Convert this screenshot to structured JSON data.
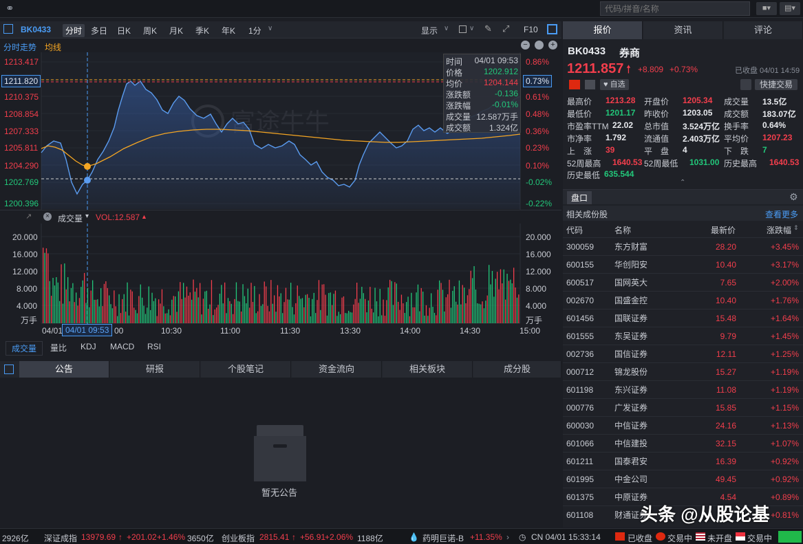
{
  "topbar": {
    "search_placeholder": "代码/拼音/名称"
  },
  "chartbar": {
    "code": "BK0433",
    "periods": [
      "分时",
      "多日",
      "日K",
      "周K",
      "月K",
      "季K",
      "年K",
      "1分"
    ],
    "display_label": "显示",
    "f10_label": "F10"
  },
  "legend": {
    "tab_intraday": "分时走势",
    "tab_avg": "均线"
  },
  "price_axis": {
    "left": [
      "1213.417",
      "1211.820",
      "1210.375",
      "1208.854",
      "1207.333",
      "1205.811",
      "1204.290",
      "1202.769",
      "1200.396"
    ],
    "right": [
      "0.86%",
      "0.73%",
      "0.61%",
      "0.48%",
      "0.36%",
      "0.23%",
      "0.10%",
      "-0.02%",
      "-0.22%"
    ]
  },
  "tooltip": {
    "rows": [
      {
        "label": "时间",
        "value": "04/01 09:53"
      },
      {
        "label": "价格",
        "value": "1202.912"
      },
      {
        "label": "均价",
        "value": "1204.144"
      },
      {
        "label": "涨跌额",
        "value": "-0.136"
      },
      {
        "label": "涨跌幅",
        "value": "-0.01%"
      },
      {
        "label": "成交量",
        "value": "12.587万手"
      },
      {
        "label": "成交额",
        "value": "1.324亿"
      }
    ]
  },
  "watermark": "富途牛牛",
  "volume": {
    "label": "成交量",
    "vol_text": "VOL:12.587",
    "axis": [
      "20.000",
      "16.000",
      "12.000",
      "8.000",
      "4.000",
      "万手"
    ]
  },
  "time_axis": [
    "04/01",
    "10:30",
    "11:00",
    "11:30",
    "13:30",
    "14:00",
    "14:30",
    "15:00"
  ],
  "cursor_time": "04/01 09:53",
  "indicators": [
    "成交量",
    "量比",
    "KDJ",
    "MACD",
    "RSI"
  ],
  "bottom_tabs": [
    "公告",
    "研报",
    "个股笔记",
    "资金流向",
    "相关板块",
    "成分股"
  ],
  "empty_text": "暂无公告",
  "right": {
    "tabs": [
      "报价",
      "资讯",
      "评论"
    ],
    "code": "BK0433",
    "name": "券商",
    "price": "1211.857",
    "change": "+8.809",
    "change_pct": "+0.73%",
    "close_status": "已收盘 04/01 14:59",
    "watch_label": "自选",
    "trade_label": "快捷交易",
    "quote": [
      [
        "最高价",
        "1213.28",
        "开盘价",
        "1205.34",
        "成交量",
        "13.5亿"
      ],
      [
        "最低价",
        "1201.17",
        "昨收价",
        "1203.05",
        "成交额",
        "183.07亿"
      ],
      [
        "市盈率TTM",
        "22.02",
        "总市值",
        "3.524万亿",
        "换手率",
        "0.64%"
      ],
      [
        "市净率",
        "1.792",
        "流通值",
        "2.403万亿",
        "平均价",
        "1207.23"
      ],
      [
        "上　涨",
        "39",
        "平　盘",
        "4",
        "下　跌",
        "7"
      ],
      [
        "52周最高",
        "1640.53",
        "52周最低",
        "1031.00",
        "历史最高",
        "1640.53"
      ]
    ],
    "hist_low_label": "历史最低",
    "hist_low": "635.544",
    "pankou": "盘口",
    "related_title": "相关成份股",
    "see_more": "查看更多",
    "table_headers": [
      "代码",
      "名称",
      "最新价",
      "涨跌幅"
    ],
    "stocks": [
      [
        "300059",
        "东方财富",
        "28.20",
        "+3.45%"
      ],
      [
        "600155",
        "华创阳安",
        "10.40",
        "+3.17%"
      ],
      [
        "600517",
        "国网英大",
        "7.65",
        "+2.00%"
      ],
      [
        "002670",
        "国盛金控",
        "10.40",
        "+1.76%"
      ],
      [
        "601456",
        "国联证券",
        "15.48",
        "+1.64%"
      ],
      [
        "601555",
        "东吴证券",
        "9.79",
        "+1.45%"
      ],
      [
        "002736",
        "国信证券",
        "12.11",
        "+1.25%"
      ],
      [
        "000712",
        "锦龙股份",
        "15.27",
        "+1.19%"
      ],
      [
        "601198",
        "东兴证券",
        "11.08",
        "+1.19%"
      ],
      [
        "000776",
        "广发证券",
        "15.85",
        "+1.15%"
      ],
      [
        "600030",
        "中信证券",
        "24.16",
        "+1.13%"
      ],
      [
        "601066",
        "中信建投",
        "32.15",
        "+1.07%"
      ],
      [
        "601211",
        "国泰君安",
        "16.39",
        "+0.92%"
      ],
      [
        "601995",
        "中金公司",
        "49.45",
        "+0.92%"
      ],
      [
        "601375",
        "中原证券",
        "4.54",
        "+0.89%"
      ],
      [
        "601108",
        "财通证券",
        "",
        "+0.81%"
      ]
    ]
  },
  "overlay_text": "头条 @从股论基",
  "status": {
    "amount1": "2926亿",
    "idx1_name": "深证成指",
    "idx1_val": "13979.69",
    "idx1_chg": "+201.02",
    "idx1_pct": "+1.46%",
    "amount2": "3650亿",
    "idx2_name": "创业板指",
    "idx2_val": "2815.41",
    "idx2_chg": "+56.91",
    "idx2_pct": "+2.06%",
    "amount3": "1188亿",
    "stock_name": "药明巨诺-B",
    "stock_pct": "+11.35%",
    "clock": "CN 04/01 15:33:14",
    "m1": "已收盘",
    "m2": "交易中",
    "m3": "未开盘",
    "m4": "交易中"
  }
}
